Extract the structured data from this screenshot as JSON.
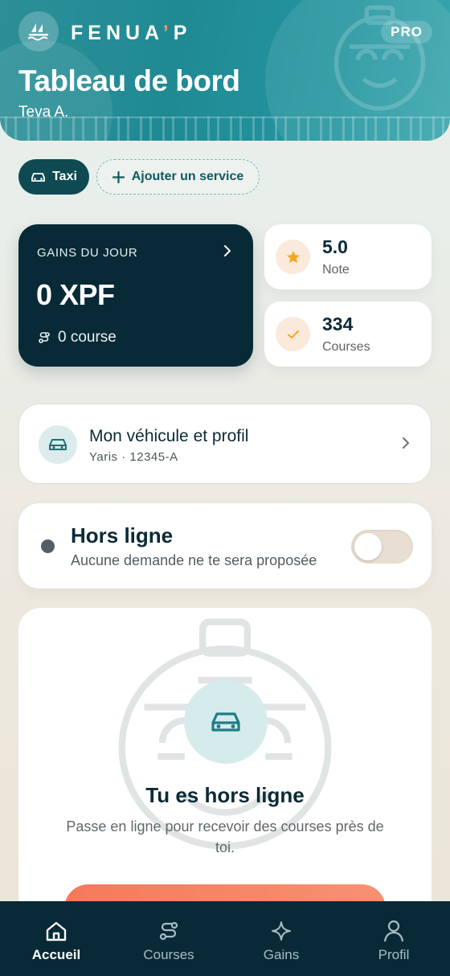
{
  "header": {
    "brand": "FENUA",
    "brand_apostrophe": "’",
    "brand_suffix": "P",
    "badge": "PRO",
    "title": "Tableau de bord",
    "user_name": "Teva A."
  },
  "services": {
    "active_label": "Taxi",
    "add_label": "Ajouter un service"
  },
  "earnings": {
    "label": "GAINS DU JOUR",
    "amount": "0 XPF",
    "rides": "0 course"
  },
  "stats": [
    {
      "value": "5.0",
      "label": "Note",
      "icon": "star-icon"
    },
    {
      "value": "334",
      "label": "Courses",
      "icon": "check-icon"
    }
  ],
  "vehicle": {
    "title": "Mon véhicule et profil",
    "subtitle": "Yaris · 12345-A"
  },
  "status": {
    "title": "Hors ligne",
    "subtitle": "Aucune demande ne te sera proposée",
    "online": false
  },
  "offline_panel": {
    "title": "Tu es hors ligne",
    "message": "Passe en ligne pour recevoir des courses près de toi."
  },
  "nav": [
    {
      "label": "Accueil",
      "icon": "home-icon",
      "active": true
    },
    {
      "label": "Courses",
      "icon": "route-icon",
      "active": false
    },
    {
      "label": "Gains",
      "icon": "sparkle-icon",
      "active": false
    },
    {
      "label": "Profil",
      "icon": "user-icon",
      "active": false
    }
  ],
  "colors": {
    "header": "#1f8a94",
    "dark": "#072a36",
    "accent": "#f57a5c",
    "star": "#f5a623"
  }
}
